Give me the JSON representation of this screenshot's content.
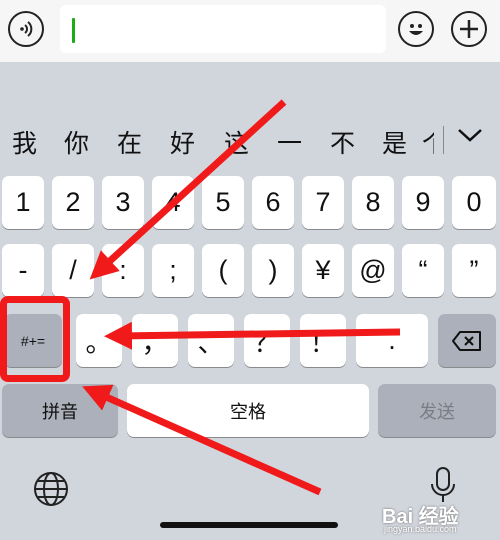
{
  "candidates": [
    "我",
    "你",
    "在",
    "好",
    "这",
    "一",
    "不",
    "是",
    "个"
  ],
  "rows": {
    "digits": [
      "1",
      "2",
      "3",
      "4",
      "5",
      "6",
      "7",
      "8",
      "9",
      "0"
    ],
    "symbols": [
      "-",
      "/",
      ":",
      ";",
      "(",
      ")",
      "¥",
      "@",
      "“",
      "”"
    ],
    "punct": [
      "。",
      "，",
      "、",
      "？",
      "！",
      "."
    ]
  },
  "keys": {
    "more_symbols": "#+=",
    "pinyin": "拼音",
    "space": "空格",
    "send": "发送"
  },
  "icons": {
    "voice": "voice-icon",
    "emoji": "emoji-icon",
    "plus": "plus-icon",
    "backspace": "backspace-icon",
    "globe": "globe-icon",
    "mic": "microphone-icon",
    "chevron": "chevron-down-icon"
  },
  "watermark": {
    "main": "Bai 经验",
    "sub": "jingyan.baidu.com"
  },
  "colors": {
    "annotation": "#f01a1a",
    "cursor": "#1aad19",
    "keyboard_bg": "#d1d5dc"
  }
}
